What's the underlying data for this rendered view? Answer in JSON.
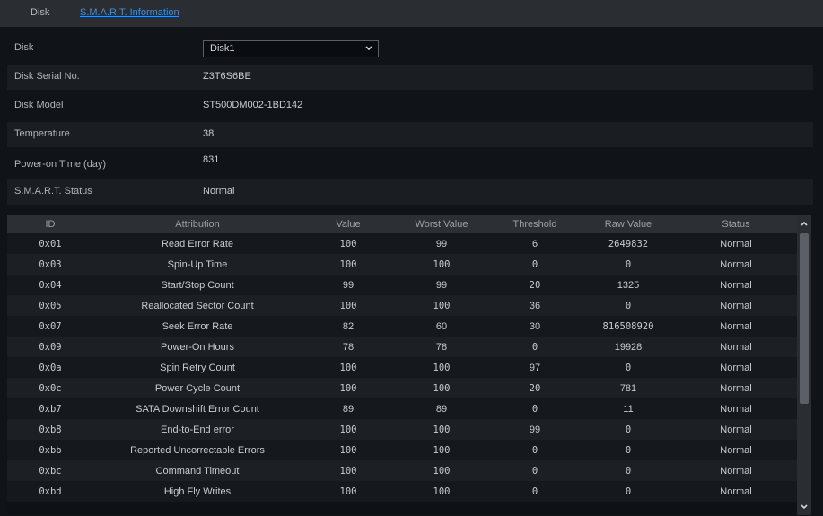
{
  "tabs": {
    "disk": "Disk",
    "smart": "S.M.A.R.T. Information"
  },
  "info": {
    "disk_label": "Disk",
    "disk_value": "Disk1",
    "serial_label": "Disk Serial No.",
    "serial_value": "Z3T6S6BE",
    "model_label": "Disk Model",
    "model_value": "ST500DM002-1BD142",
    "temp_label": "Temperature",
    "temp_value": "38",
    "power_label": "Power-on Time (day)",
    "power_value": "831",
    "status_label": "S.M.A.R.T. Status",
    "status_value": "Normal"
  },
  "table": {
    "headers": {
      "id": "ID",
      "attribution": "Attribution",
      "value": "Value",
      "worst": "Worst Value",
      "threshold": "Threshold",
      "raw": "Raw Value",
      "status": "Status"
    },
    "rows": [
      {
        "id": "0x01",
        "attribution": "Read Error Rate",
        "value": "100",
        "worst": "99",
        "threshold": "6",
        "raw": "2649832",
        "status": "Normal"
      },
      {
        "id": "0x03",
        "attribution": "Spin-Up Time",
        "value": "100",
        "worst": "100",
        "threshold": "0",
        "raw": "0",
        "status": "Normal"
      },
      {
        "id": "0x04",
        "attribution": "Start/Stop Count",
        "value": "99",
        "worst": "99",
        "threshold": "20",
        "raw": "1325",
        "status": "Normal"
      },
      {
        "id": "0x05",
        "attribution": "Reallocated Sector Count",
        "value": "100",
        "worst": "100",
        "threshold": "36",
        "raw": "0",
        "status": "Normal"
      },
      {
        "id": "0x07",
        "attribution": "Seek Error Rate",
        "value": "82",
        "worst": "60",
        "threshold": "30",
        "raw": "816508920",
        "status": "Normal"
      },
      {
        "id": "0x09",
        "attribution": "Power-On Hours",
        "value": "78",
        "worst": "78",
        "threshold": "0",
        "raw": "19928",
        "status": "Normal"
      },
      {
        "id": "0x0a",
        "attribution": "Spin Retry Count",
        "value": "100",
        "worst": "100",
        "threshold": "97",
        "raw": "0",
        "status": "Normal"
      },
      {
        "id": "0x0c",
        "attribution": "Power Cycle Count",
        "value": "100",
        "worst": "100",
        "threshold": "20",
        "raw": "781",
        "status": "Normal"
      },
      {
        "id": "0xb7",
        "attribution": "SATA Downshift Error Count",
        "value": "89",
        "worst": "89",
        "threshold": "0",
        "raw": "11",
        "status": "Normal"
      },
      {
        "id": "0xb8",
        "attribution": "End-to-End error",
        "value": "100",
        "worst": "100",
        "threshold": "99",
        "raw": "0",
        "status": "Normal"
      },
      {
        "id": "0xbb",
        "attribution": "Reported Uncorrectable Errors",
        "value": "100",
        "worst": "100",
        "threshold": "0",
        "raw": "0",
        "status": "Normal"
      },
      {
        "id": "0xbc",
        "attribution": "Command Timeout",
        "value": "100",
        "worst": "100",
        "threshold": "0",
        "raw": "0",
        "status": "Normal"
      },
      {
        "id": "0xbd",
        "attribution": "High Fly Writes",
        "value": "100",
        "worst": "100",
        "threshold": "0",
        "raw": "0",
        "status": "Normal"
      }
    ]
  },
  "icons": {
    "dropdown": "chevron-down-icon",
    "scroll_up": "chevron-up-icon",
    "scroll_down": "chevron-down-icon"
  },
  "colors": {
    "link": "#3c8fe6",
    "background": "#101317",
    "header": "#2c3035"
  }
}
